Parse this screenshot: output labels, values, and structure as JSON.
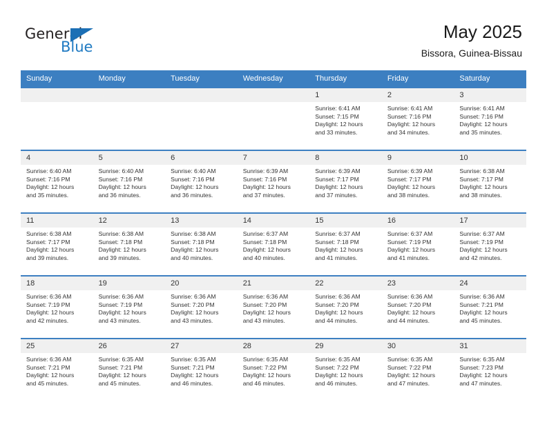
{
  "brand": {
    "name_top": "General",
    "name_bottom": "Blue",
    "color_blue": "#1f7ac2",
    "color_dark": "#231f20"
  },
  "header": {
    "title": "May 2025",
    "subtitle": "Bissora, Guinea-Bissau",
    "header_bg": "#3c7fc1",
    "band_bg": "#f0f0f0"
  },
  "weekdays": [
    "Sunday",
    "Monday",
    "Tuesday",
    "Wednesday",
    "Thursday",
    "Friday",
    "Saturday"
  ],
  "weeks": [
    [
      {
        "day": "",
        "sunrise": "",
        "sunset": "",
        "daylight1": "",
        "daylight2": "",
        "empty": true
      },
      {
        "day": "",
        "sunrise": "",
        "sunset": "",
        "daylight1": "",
        "daylight2": "",
        "empty": true
      },
      {
        "day": "",
        "sunrise": "",
        "sunset": "",
        "daylight1": "",
        "daylight2": "",
        "empty": true
      },
      {
        "day": "",
        "sunrise": "",
        "sunset": "",
        "daylight1": "",
        "daylight2": "",
        "empty": true
      },
      {
        "day": "1",
        "sunrise": "Sunrise: 6:41 AM",
        "sunset": "Sunset: 7:15 PM",
        "daylight1": "Daylight: 12 hours",
        "daylight2": "and 33 minutes."
      },
      {
        "day": "2",
        "sunrise": "Sunrise: 6:41 AM",
        "sunset": "Sunset: 7:16 PM",
        "daylight1": "Daylight: 12 hours",
        "daylight2": "and 34 minutes."
      },
      {
        "day": "3",
        "sunrise": "Sunrise: 6:41 AM",
        "sunset": "Sunset: 7:16 PM",
        "daylight1": "Daylight: 12 hours",
        "daylight2": "and 35 minutes."
      }
    ],
    [
      {
        "day": "4",
        "sunrise": "Sunrise: 6:40 AM",
        "sunset": "Sunset: 7:16 PM",
        "daylight1": "Daylight: 12 hours",
        "daylight2": "and 35 minutes."
      },
      {
        "day": "5",
        "sunrise": "Sunrise: 6:40 AM",
        "sunset": "Sunset: 7:16 PM",
        "daylight1": "Daylight: 12 hours",
        "daylight2": "and 36 minutes."
      },
      {
        "day": "6",
        "sunrise": "Sunrise: 6:40 AM",
        "sunset": "Sunset: 7:16 PM",
        "daylight1": "Daylight: 12 hours",
        "daylight2": "and 36 minutes."
      },
      {
        "day": "7",
        "sunrise": "Sunrise: 6:39 AM",
        "sunset": "Sunset: 7:16 PM",
        "daylight1": "Daylight: 12 hours",
        "daylight2": "and 37 minutes."
      },
      {
        "day": "8",
        "sunrise": "Sunrise: 6:39 AM",
        "sunset": "Sunset: 7:17 PM",
        "daylight1": "Daylight: 12 hours",
        "daylight2": "and 37 minutes."
      },
      {
        "day": "9",
        "sunrise": "Sunrise: 6:39 AM",
        "sunset": "Sunset: 7:17 PM",
        "daylight1": "Daylight: 12 hours",
        "daylight2": "and 38 minutes."
      },
      {
        "day": "10",
        "sunrise": "Sunrise: 6:38 AM",
        "sunset": "Sunset: 7:17 PM",
        "daylight1": "Daylight: 12 hours",
        "daylight2": "and 38 minutes."
      }
    ],
    [
      {
        "day": "11",
        "sunrise": "Sunrise: 6:38 AM",
        "sunset": "Sunset: 7:17 PM",
        "daylight1": "Daylight: 12 hours",
        "daylight2": "and 39 minutes."
      },
      {
        "day": "12",
        "sunrise": "Sunrise: 6:38 AM",
        "sunset": "Sunset: 7:18 PM",
        "daylight1": "Daylight: 12 hours",
        "daylight2": "and 39 minutes."
      },
      {
        "day": "13",
        "sunrise": "Sunrise: 6:38 AM",
        "sunset": "Sunset: 7:18 PM",
        "daylight1": "Daylight: 12 hours",
        "daylight2": "and 40 minutes."
      },
      {
        "day": "14",
        "sunrise": "Sunrise: 6:37 AM",
        "sunset": "Sunset: 7:18 PM",
        "daylight1": "Daylight: 12 hours",
        "daylight2": "and 40 minutes."
      },
      {
        "day": "15",
        "sunrise": "Sunrise: 6:37 AM",
        "sunset": "Sunset: 7:18 PM",
        "daylight1": "Daylight: 12 hours",
        "daylight2": "and 41 minutes."
      },
      {
        "day": "16",
        "sunrise": "Sunrise: 6:37 AM",
        "sunset": "Sunset: 7:19 PM",
        "daylight1": "Daylight: 12 hours",
        "daylight2": "and 41 minutes."
      },
      {
        "day": "17",
        "sunrise": "Sunrise: 6:37 AM",
        "sunset": "Sunset: 7:19 PM",
        "daylight1": "Daylight: 12 hours",
        "daylight2": "and 42 minutes."
      }
    ],
    [
      {
        "day": "18",
        "sunrise": "Sunrise: 6:36 AM",
        "sunset": "Sunset: 7:19 PM",
        "daylight1": "Daylight: 12 hours",
        "daylight2": "and 42 minutes."
      },
      {
        "day": "19",
        "sunrise": "Sunrise: 6:36 AM",
        "sunset": "Sunset: 7:19 PM",
        "daylight1": "Daylight: 12 hours",
        "daylight2": "and 43 minutes."
      },
      {
        "day": "20",
        "sunrise": "Sunrise: 6:36 AM",
        "sunset": "Sunset: 7:20 PM",
        "daylight1": "Daylight: 12 hours",
        "daylight2": "and 43 minutes."
      },
      {
        "day": "21",
        "sunrise": "Sunrise: 6:36 AM",
        "sunset": "Sunset: 7:20 PM",
        "daylight1": "Daylight: 12 hours",
        "daylight2": "and 43 minutes."
      },
      {
        "day": "22",
        "sunrise": "Sunrise: 6:36 AM",
        "sunset": "Sunset: 7:20 PM",
        "daylight1": "Daylight: 12 hours",
        "daylight2": "and 44 minutes."
      },
      {
        "day": "23",
        "sunrise": "Sunrise: 6:36 AM",
        "sunset": "Sunset: 7:20 PM",
        "daylight1": "Daylight: 12 hours",
        "daylight2": "and 44 minutes."
      },
      {
        "day": "24",
        "sunrise": "Sunrise: 6:36 AM",
        "sunset": "Sunset: 7:21 PM",
        "daylight1": "Daylight: 12 hours",
        "daylight2": "and 45 minutes."
      }
    ],
    [
      {
        "day": "25",
        "sunrise": "Sunrise: 6:36 AM",
        "sunset": "Sunset: 7:21 PM",
        "daylight1": "Daylight: 12 hours",
        "daylight2": "and 45 minutes."
      },
      {
        "day": "26",
        "sunrise": "Sunrise: 6:35 AM",
        "sunset": "Sunset: 7:21 PM",
        "daylight1": "Daylight: 12 hours",
        "daylight2": "and 45 minutes."
      },
      {
        "day": "27",
        "sunrise": "Sunrise: 6:35 AM",
        "sunset": "Sunset: 7:21 PM",
        "daylight1": "Daylight: 12 hours",
        "daylight2": "and 46 minutes."
      },
      {
        "day": "28",
        "sunrise": "Sunrise: 6:35 AM",
        "sunset": "Sunset: 7:22 PM",
        "daylight1": "Daylight: 12 hours",
        "daylight2": "and 46 minutes."
      },
      {
        "day": "29",
        "sunrise": "Sunrise: 6:35 AM",
        "sunset": "Sunset: 7:22 PM",
        "daylight1": "Daylight: 12 hours",
        "daylight2": "and 46 minutes."
      },
      {
        "day": "30",
        "sunrise": "Sunrise: 6:35 AM",
        "sunset": "Sunset: 7:22 PM",
        "daylight1": "Daylight: 12 hours",
        "daylight2": "and 47 minutes."
      },
      {
        "day": "31",
        "sunrise": "Sunrise: 6:35 AM",
        "sunset": "Sunset: 7:23 PM",
        "daylight1": "Daylight: 12 hours",
        "daylight2": "and 47 minutes."
      }
    ]
  ]
}
